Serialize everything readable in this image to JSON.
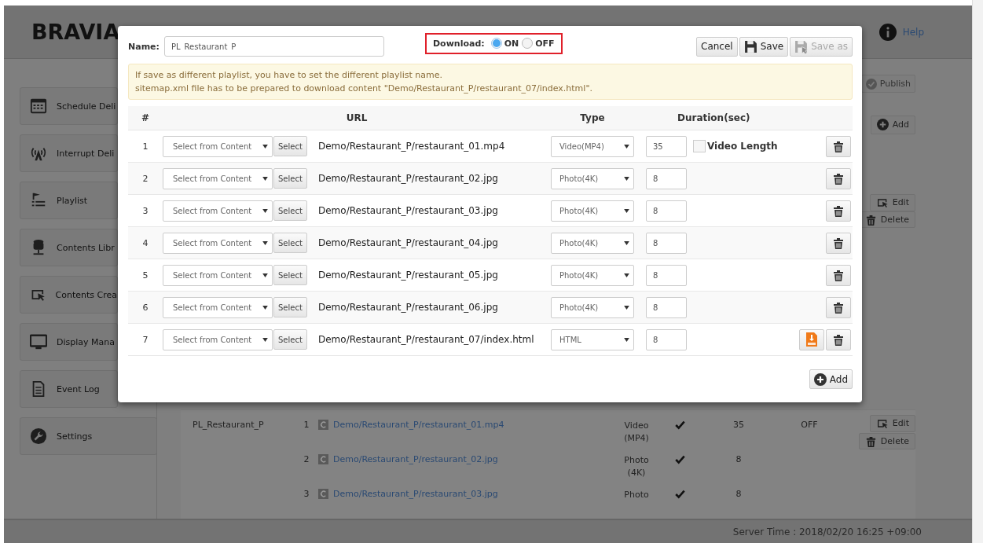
{
  "header": {
    "logo": "BRAVIA",
    "help": "Help"
  },
  "sidebar": {
    "items": [
      {
        "label": "Schedule Deli"
      },
      {
        "label": "Interrupt Deli"
      },
      {
        "label": "Playlist"
      },
      {
        "label": "Contents Libr"
      },
      {
        "label": "Contents Crea"
      },
      {
        "label": "Display Mana"
      },
      {
        "label": "Event Log"
      },
      {
        "label": "Settings"
      }
    ]
  },
  "background": {
    "publish": "Publish",
    "add": "Add",
    "edit": "Edit",
    "delete": "Delete",
    "playlist": {
      "name": "PL_Restaurant_P",
      "download": "OFF",
      "edit": "Edit",
      "delete": "Delete",
      "items": [
        {
          "number": "1",
          "url": "Demo/Restaurant_P/restaurant_01.mp4",
          "type": "Video (MP4)",
          "enabled": true,
          "duration": "35"
        },
        {
          "number": "2",
          "url": "Demo/Restaurant_P/restaurant_02.jpg",
          "type": "Photo (4K)",
          "enabled": true,
          "duration": "8"
        },
        {
          "number": "3",
          "url": "Demo/Restaurant_P/restaurant_03.jpg",
          "type": "Photo",
          "enabled": true,
          "duration": "8"
        }
      ]
    }
  },
  "modal": {
    "name_label": "Name:",
    "name_value": "PL_Restaurant_P",
    "download": {
      "label": "Download:",
      "options": [
        {
          "label": "ON",
          "selected": true
        },
        {
          "label": "OFF",
          "selected": false
        }
      ]
    },
    "buttons": [
      {
        "label": "Cancel",
        "kind": "cancel",
        "disabled": false
      },
      {
        "label": "Save",
        "kind": "save",
        "disabled": false
      },
      {
        "label": "Save as",
        "kind": "save_as",
        "disabled": true
      }
    ],
    "notice": [
      "If save as different playlist, you have to set the different playlist name.",
      "sitemap.xml file has to be prepared to download content \"Demo/Restaurant_P/restaurant_07/index.html\"."
    ],
    "columns": [
      "#",
      "URL",
      "Type",
      "Duration(sec)"
    ],
    "rows": [
      {
        "number": "1",
        "source": "Select from Content",
        "select": "Select",
        "url": "Demo/Restaurant_P/restaurant_01.mp4",
        "type": "Video(MP4)",
        "duration": "35",
        "video_length": {
          "label": "Video Length",
          "checked": false
        },
        "package_icon": false
      },
      {
        "number": "2",
        "source": "Select from Content",
        "select": "Select",
        "url": "Demo/Restaurant_P/restaurant_02.jpg",
        "type": "Photo(4K)",
        "duration": "8",
        "package_icon": false
      },
      {
        "number": "3",
        "source": "Select from Content",
        "select": "Select",
        "url": "Demo/Restaurant_P/restaurant_03.jpg",
        "type": "Photo(4K)",
        "duration": "8",
        "package_icon": false
      },
      {
        "number": "4",
        "source": "Select from Content",
        "select": "Select",
        "url": "Demo/Restaurant_P/restaurant_04.jpg",
        "type": "Photo(4K)",
        "duration": "8",
        "package_icon": false
      },
      {
        "number": "5",
        "source": "Select from Content",
        "select": "Select",
        "url": "Demo/Restaurant_P/restaurant_05.jpg",
        "type": "Photo(4K)",
        "duration": "8",
        "package_icon": false
      },
      {
        "number": "6",
        "source": "Select from Content",
        "select": "Select",
        "url": "Demo/Restaurant_P/restaurant_06.jpg",
        "type": "Photo(4K)",
        "duration": "8",
        "package_icon": false
      },
      {
        "number": "7",
        "source": "Select from Content",
        "select": "Select",
        "url": "Demo/Restaurant_P/restaurant_07/index.html",
        "type": "HTML",
        "duration": "8",
        "package_icon": true
      }
    ],
    "add": "Add"
  },
  "status_bar": {
    "server_time": "Server Time : 2018/02/20 16:25 +09:00"
  }
}
